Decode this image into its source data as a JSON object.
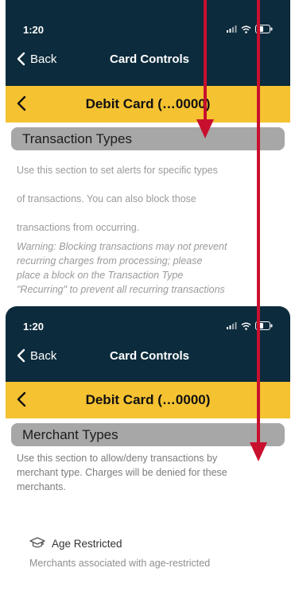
{
  "colors": {
    "header_bg": "#0c2b3c",
    "accent_yellow": "#f5c232",
    "section_gray": "#a7a7a7",
    "arrow_red": "#c8102e"
  },
  "icons": {
    "back": "chevron-left-icon",
    "signal": "signal-icon",
    "wifi": "wifi-icon",
    "battery": "battery-icon",
    "merchant": "graduation-cap-icon"
  },
  "top_screen": {
    "status_time": "1:20",
    "back_label": "Back",
    "nav_title": "Card Controls",
    "card_title": "Debit Card (…0000)",
    "section_title": "Transaction Types",
    "para_line1": "Use this section to set alerts for specific types",
    "para_line2": "of transactions. You can also block those",
    "para_line3": "transactions from occurring.",
    "warning_line1": "Warning: Blocking transactions may not prevent",
    "warning_line2": "recurring charges from processing; please",
    "warning_line3": "place a block on the Transaction Type",
    "warning_line4": "\"Recurring\" to prevent all recurring transactions"
  },
  "bottom_screen": {
    "status_time": "1:20",
    "back_label": "Back",
    "nav_title": "Card Controls",
    "card_title": "Debit Card (…0000)",
    "section_title": "Merchant Types",
    "para_line1": "Use this section to allow/deny transactions by",
    "para_line2": "merchant type. Charges will be denied for these",
    "para_line3": "merchants.",
    "merchant_label": "Age Restricted",
    "merchant_desc": "Merchants associated with age-restricted"
  }
}
